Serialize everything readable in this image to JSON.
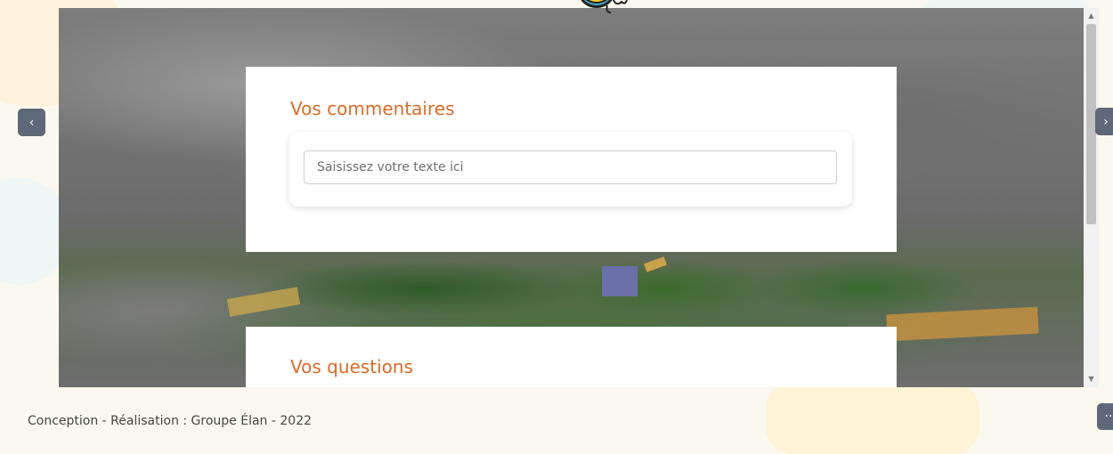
{
  "carousel": {
    "prev_label": "‹",
    "next_label": "›"
  },
  "comment_card": {
    "title": "Vos commentaires",
    "input_placeholder": "Saisissez votre texte ici"
  },
  "questions_card": {
    "title": "Vos questions"
  },
  "footer": {
    "credit": "Conception - Réalisation : Groupe Élan - 2022",
    "more_label": "··"
  },
  "colors": {
    "accent": "#dd6a26",
    "nav_button": "#5e6878",
    "background": "#fbf9ef"
  },
  "icons": {
    "mascot": "bee-mascot-icon",
    "prev": "chevron-left-icon",
    "next": "chevron-right-icon",
    "more": "more-dots-icon"
  }
}
